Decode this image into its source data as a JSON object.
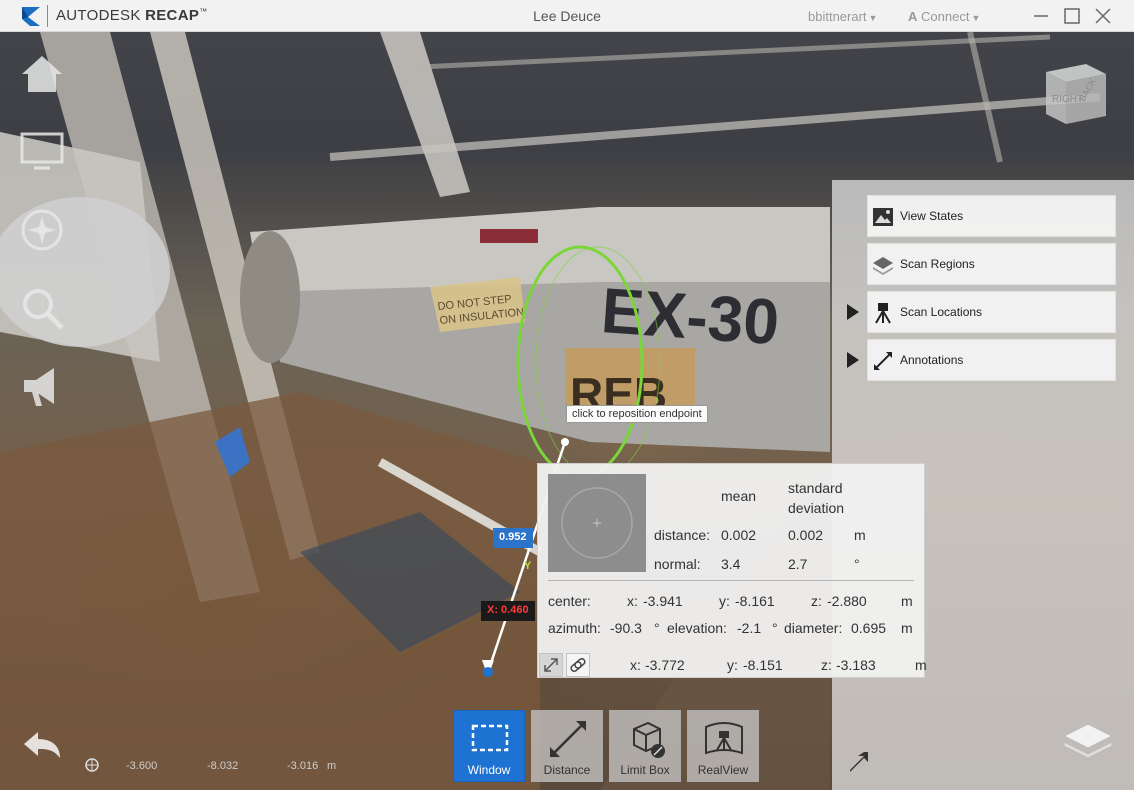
{
  "app": {
    "brand_light": "AUTODESK",
    "brand_bold": "RECAP",
    "brand_tm": "™",
    "project_name": "Lee Deuce",
    "user_name": "bbittnerart",
    "connect_label": "Connect",
    "accent_color": "#1e73d2"
  },
  "window_controls": {
    "minimize": "minimize-icon",
    "maximize": "maximize-icon",
    "close": "close-icon"
  },
  "left_nav": [
    "home-icon",
    "display-settings-icon",
    "navigate-icon",
    "zoom-icon",
    "announce-icon",
    "back-icon"
  ],
  "view_cube": {
    "face_right": "RIGHT",
    "face_back": "BACK",
    "face_top": "TOP"
  },
  "right_panel": {
    "items": [
      {
        "label": "View States",
        "icon": "image-icon",
        "expandable": false
      },
      {
        "label": "Scan Regions",
        "icon": "layers-icon",
        "expandable": false
      },
      {
        "label": "Scan Locations",
        "icon": "tripod-icon",
        "expandable": true
      },
      {
        "label": "Annotations",
        "icon": "measure-icon",
        "expandable": true
      }
    ]
  },
  "tooltip": {
    "text": "click to reposition endpoint"
  },
  "axis_labels": {
    "y_value": "0.952",
    "x_value": "X: 0.460",
    "y_axis": "Y"
  },
  "measurement": {
    "header_mean": "mean",
    "header_std": "standard deviation",
    "rows": [
      {
        "label": "distance:",
        "mean": "0.002",
        "std": "0.002",
        "unit": "m"
      },
      {
        "label": "normal:",
        "mean": "3.4",
        "std": "2.7",
        "unit": "°"
      }
    ],
    "center": {
      "label": "center:",
      "x_label": "x:",
      "x": "-3.941",
      "y_label": "y:",
      "y": "-8.161",
      "z_label": "z:",
      "z": "-2.880",
      "unit": "m"
    },
    "angles": {
      "azimuth_label": "azimuth:",
      "azimuth": "-90.3",
      "azimuth_unit": "°",
      "elevation_label": "elevation:",
      "elevation": "-2.1",
      "elevation_unit": "°",
      "diameter_label": "diameter:",
      "diameter": "0.695",
      "diameter_unit": "m"
    },
    "endpoint": {
      "x_label": "x:",
      "x": "-3.772",
      "y_label": "y:",
      "y": "-8.151",
      "z_label": "z:",
      "z": "-3.183",
      "unit": "m"
    }
  },
  "toolbar": [
    {
      "label": "Window",
      "active": true,
      "icon": "window-select-icon"
    },
    {
      "label": "Distance",
      "active": false,
      "icon": "distance-icon"
    },
    {
      "label": "Limit Box",
      "active": false,
      "icon": "limit-box-icon"
    },
    {
      "label": "RealView",
      "active": false,
      "icon": "realview-icon"
    }
  ],
  "cursor_coords": {
    "x": "-3.600",
    "y": "-8.032",
    "z": "-3.016",
    "unit": "m"
  },
  "scene_text": {
    "pipe_tag": "EX-30",
    "pipe_tag2": "REB",
    "warning_label": "DO NOT STEP ON INSULATION"
  }
}
